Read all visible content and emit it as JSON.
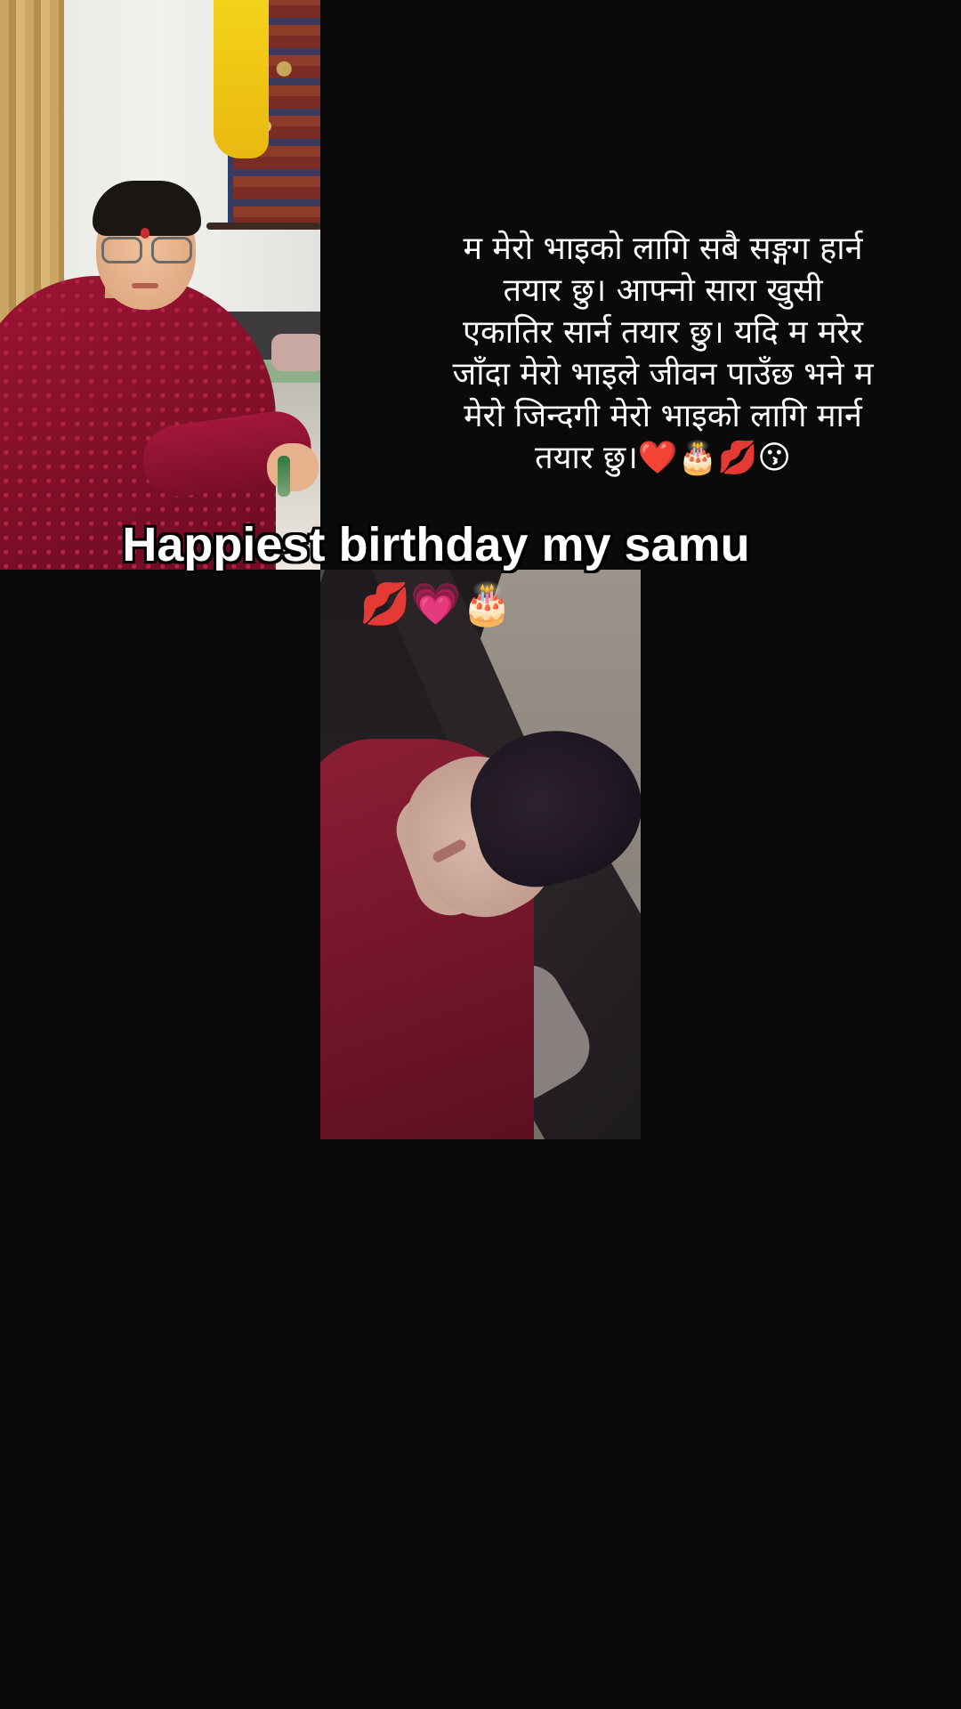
{
  "poem": {
    "text": "म मेरो भाइको लागि सबै सङ्गग हार्न\nतयार छु। आफ्नो सारा खुसी\nएकातिर सार्न तयार छु। यदि म मरेर\nजाँदा मेरो भाइले जीवन पाउँछ भने म\nमेरो जिन्दगी  मेरो भाइको लागि मार्न\nतयार छु।❤️🎂💋😗"
  },
  "caption": {
    "line1": "Happiest birthday my samu",
    "line2": "💋💗🎂"
  },
  "photos": {
    "photo1": "portrait-boy-red-kurta",
    "photo2": "selfie-boy-red-sweater"
  },
  "colors": {
    "background": "#0b0a0b",
    "text": "#ffffff",
    "text_outline": "#000000"
  }
}
